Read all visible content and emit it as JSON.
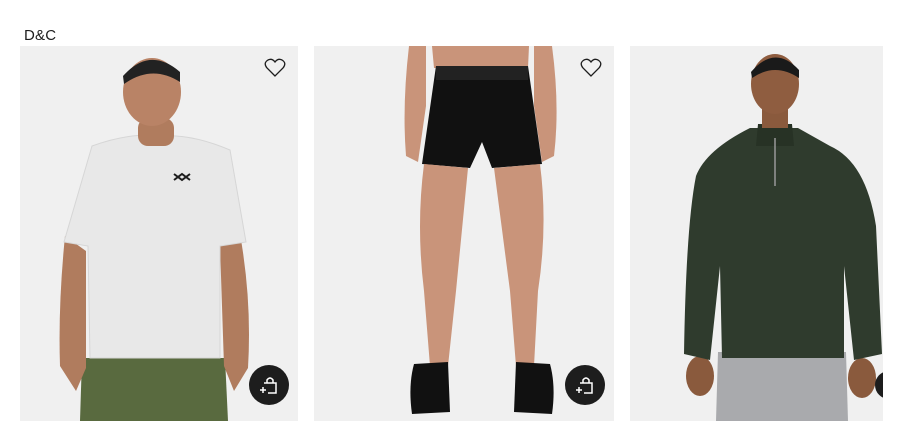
{
  "brand": "D&C",
  "products": [
    {
      "name": "grey-tee",
      "wishlist_icon": "heart-outline-icon",
      "quick_add_icon": "bag-plus-icon"
    },
    {
      "name": "black-shorts",
      "wishlist_icon": "heart-outline-icon",
      "quick_add_icon": "bag-plus-icon"
    },
    {
      "name": "green-quarter-zip",
      "wishlist_icon": "heart-outline-icon",
      "quick_add_icon": "bag-plus-icon"
    }
  ],
  "colors": {
    "card_bg": "#f0f0f0",
    "button_bg": "#1d1d1d",
    "text": "#1d1d1d"
  }
}
